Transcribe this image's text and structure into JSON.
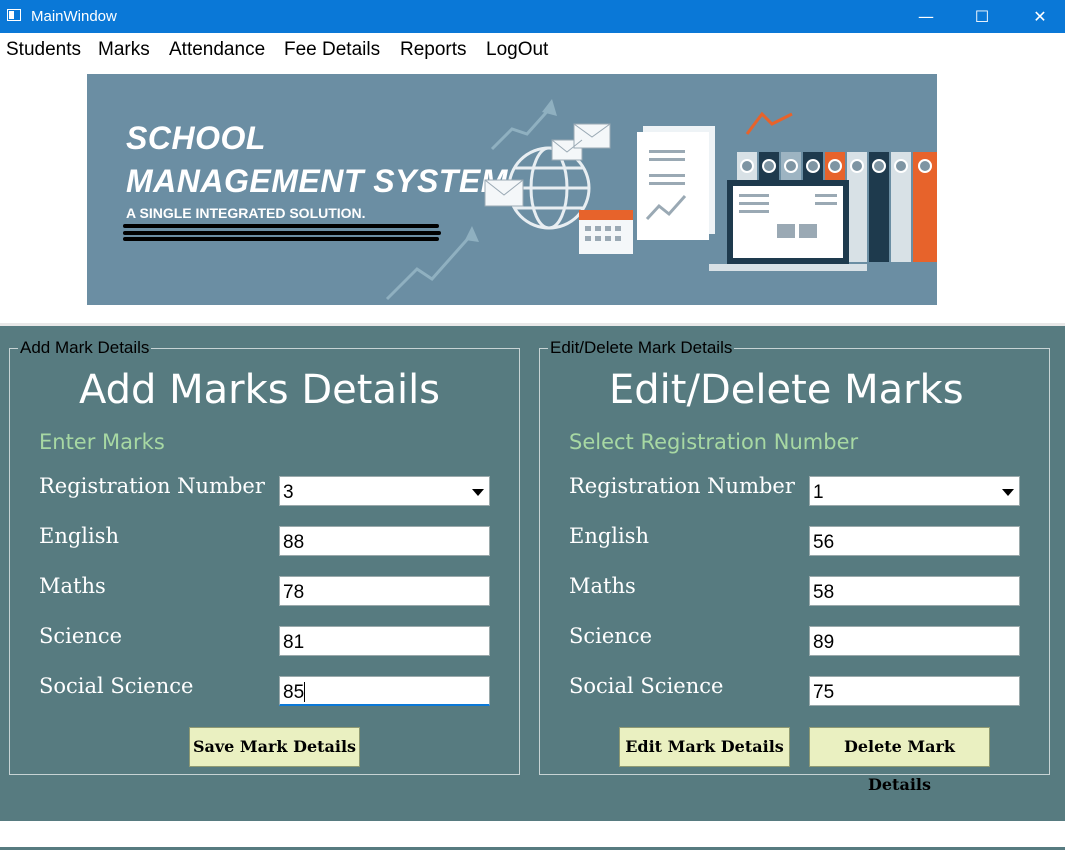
{
  "window": {
    "title": "MainWindow",
    "minimize": "—",
    "maximize": "☐",
    "close": "✕"
  },
  "menu": {
    "items": [
      "Students",
      "Marks",
      "Attendance",
      "Fee Details",
      "Reports",
      "LogOut"
    ]
  },
  "banner": {
    "title_line1": "SCHOOL",
    "title_line2": "MANAGEMENT SYSTEM",
    "subtitle": "A SINGLE INTEGRATED SOLUTION.",
    "accent": "#e7632b",
    "background": "#6b8ea3"
  },
  "add_group": {
    "title": "Add Mark Details",
    "heading": "Add Marks Details",
    "subheading": "Enter Marks",
    "fields": [
      {
        "label": "Registration Number",
        "value": "3"
      },
      {
        "label": "English",
        "value": "88"
      },
      {
        "label": "Maths",
        "value": "78"
      },
      {
        "label": "Science",
        "value": "81"
      },
      {
        "label": "Social Science",
        "value": "85"
      }
    ],
    "save_button": "Save Mark Details"
  },
  "edit_group": {
    "title": "Edit/Delete Mark Details",
    "heading": "Edit/Delete Marks",
    "subheading": "Select Registration Number",
    "fields": [
      {
        "label": "Registration Number",
        "value": "1"
      },
      {
        "label": "English",
        "value": "56"
      },
      {
        "label": "Maths",
        "value": "58"
      },
      {
        "label": "Science",
        "value": "89"
      },
      {
        "label": "Social Science",
        "value": "75"
      }
    ],
    "edit_button": "Edit Mark Details",
    "delete_button": "Delete Mark Details"
  },
  "colors": {
    "titlebar": "#0a78d7",
    "panel": "#577b80",
    "subheading": "#a7d8a3",
    "button": "#eaf0c1"
  }
}
